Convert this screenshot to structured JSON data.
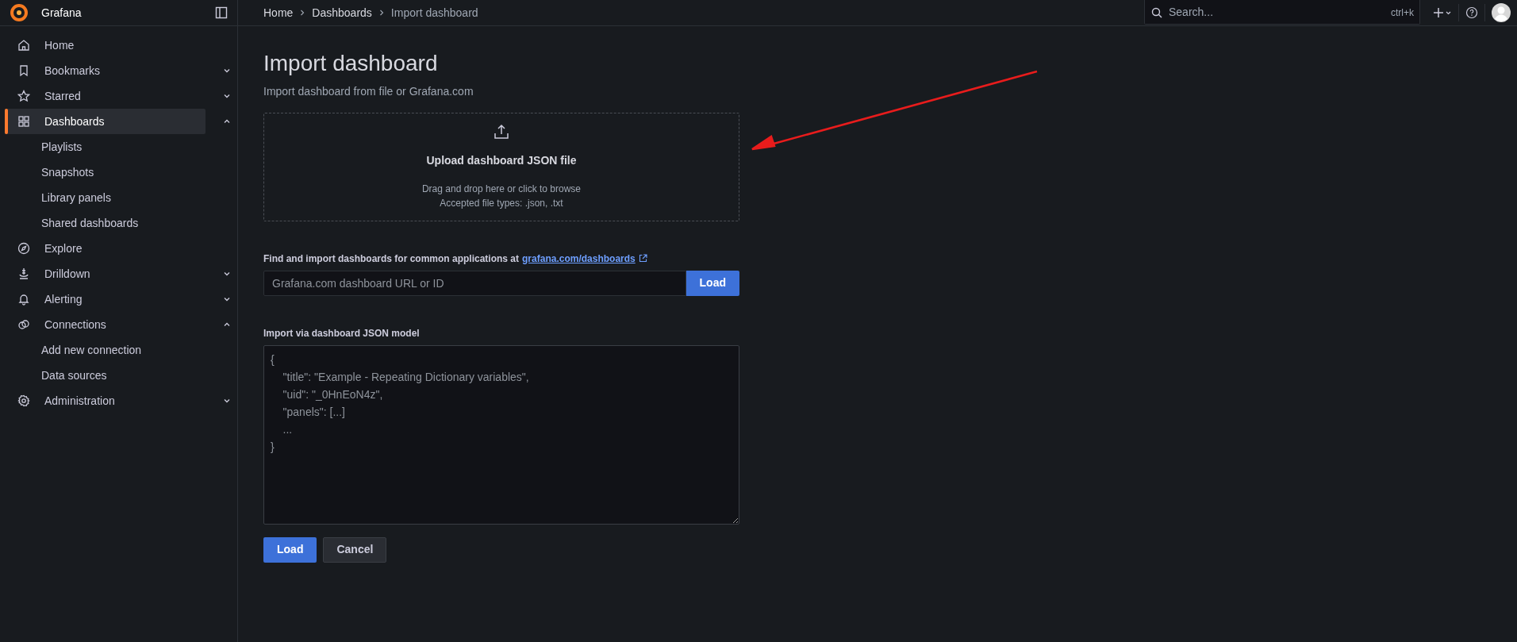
{
  "app": {
    "name": "Grafana"
  },
  "sidebar": {
    "items": [
      {
        "label": "Home",
        "selected": false
      },
      {
        "label": "Bookmarks",
        "selected": false,
        "expanded": false
      },
      {
        "label": "Starred",
        "selected": false,
        "expanded": false
      },
      {
        "label": "Dashboards",
        "selected": true,
        "expanded": true,
        "children": [
          {
            "label": "Playlists"
          },
          {
            "label": "Snapshots"
          },
          {
            "label": "Library panels"
          },
          {
            "label": "Shared dashboards"
          }
        ]
      },
      {
        "label": "Explore",
        "selected": false
      },
      {
        "label": "Drilldown",
        "selected": false,
        "expanded": false
      },
      {
        "label": "Alerting",
        "selected": false,
        "expanded": false
      },
      {
        "label": "Connections",
        "selected": false,
        "expanded": true,
        "children": [
          {
            "label": "Add new connection"
          },
          {
            "label": "Data sources"
          }
        ]
      },
      {
        "label": "Administration",
        "selected": false,
        "expanded": false
      }
    ]
  },
  "breadcrumbs": [
    {
      "label": "Home",
      "current": false
    },
    {
      "label": "Dashboards",
      "current": false
    },
    {
      "label": "Import dashboard",
      "current": true
    }
  ],
  "search": {
    "placeholder": "Search...",
    "shortcut": "ctrl+k"
  },
  "page": {
    "title": "Import dashboard",
    "subtitle": "Import dashboard from file or Grafana.com",
    "upload": {
      "title": "Upload dashboard JSON file",
      "hint": "Drag and drop here or click to browse",
      "accepted": "Accepted file types: .json, .txt"
    },
    "grafana_com": {
      "label": "Find and import dashboards for common applications at",
      "link": "grafana.com/dashboards",
      "placeholder": "Grafana.com dashboard URL or ID",
      "button": "Load"
    },
    "json_model": {
      "label": "Import via dashboard JSON model",
      "placeholder": "{\n    \"title\": \"Example - Repeating Dictionary variables\",\n    \"uid\": \"_0HnEoN4z\",\n    \"panels\": [...]\n    ...\n}"
    },
    "buttons": [
      {
        "label": "Load",
        "kind": "primary"
      },
      {
        "label": "Cancel",
        "kind": "secondary"
      }
    ]
  }
}
